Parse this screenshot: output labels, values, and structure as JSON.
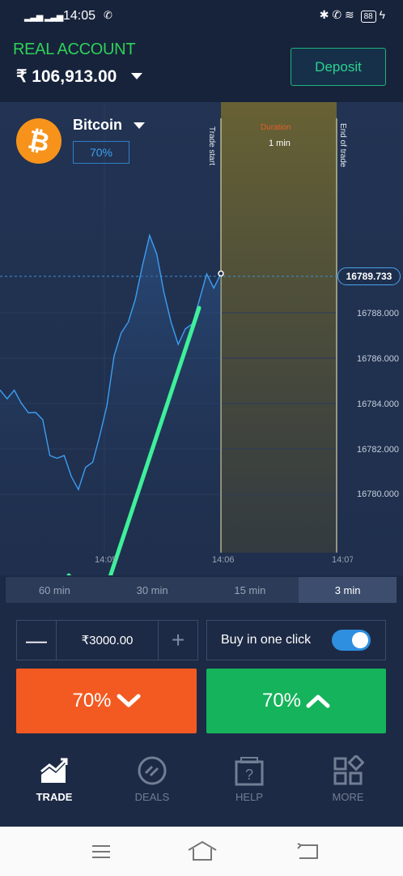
{
  "status_bar": {
    "time": "14:05",
    "battery": "88"
  },
  "account": {
    "type": "REAL ACCOUNT",
    "balance": "₹ 106,913.00",
    "deposit_label": "Deposit"
  },
  "asset": {
    "name": "Bitcoin",
    "payout": "70%"
  },
  "chart": {
    "trade_start_label": "Trade start",
    "duration_label": "Duration",
    "duration_value": "1 min",
    "end_label": "End of trade",
    "current_price": "16789.733",
    "y_ticks": [
      "16788.000",
      "16786.000",
      "16784.000",
      "16782.000",
      "16780.000"
    ],
    "x_ticks": [
      "14:05",
      "14:06",
      "14:07"
    ]
  },
  "chart_data": {
    "type": "line",
    "title": "",
    "xlabel": "",
    "ylabel": "",
    "ylim": [
      16778.0,
      16794.0
    ],
    "series": [
      {
        "values": [
          16784.6,
          16784.3,
          16784.5,
          16784.1,
          16783.5,
          16783.7,
          16783.2,
          16781.8,
          16781.5,
          16781.8,
          16780.7,
          16780.3,
          16781.1,
          16781.5,
          16782.5,
          16784.0,
          16786.0,
          16787.2,
          16787.5,
          16788.7,
          16790.0,
          16791.5,
          16790.5,
          16789.0,
          16787.5,
          16786.7,
          16787.2,
          16787.6,
          16788.5,
          16789.8,
          16789.0,
          16789.73
        ]
      }
    ]
  },
  "timeframes": [
    {
      "label": "60 min",
      "active": false
    },
    {
      "label": "30 min",
      "active": false
    },
    {
      "label": "15 min",
      "active": false
    },
    {
      "label": "3 min",
      "active": true
    }
  ],
  "order": {
    "minus": "—",
    "amount": "₹3000.00",
    "plus": "+",
    "one_click_label": "Buy in one click",
    "one_click_enabled": true
  },
  "buttons": {
    "down_label": "70%",
    "up_label": "70%"
  },
  "nav": [
    {
      "label": "TRADE",
      "icon": "chart-trend-icon",
      "active": true
    },
    {
      "label": "DEALS",
      "icon": "deals-icon",
      "active": false
    },
    {
      "label": "HELP",
      "icon": "help-icon",
      "active": false
    },
    {
      "label": "MORE",
      "icon": "grid-icon",
      "active": false
    }
  ],
  "colors": {
    "accent_green": "#15b35b",
    "accent_orange": "#f25a21",
    "accent_blue": "#2e8fe0",
    "annotation_arrow": "#3ef09a"
  }
}
